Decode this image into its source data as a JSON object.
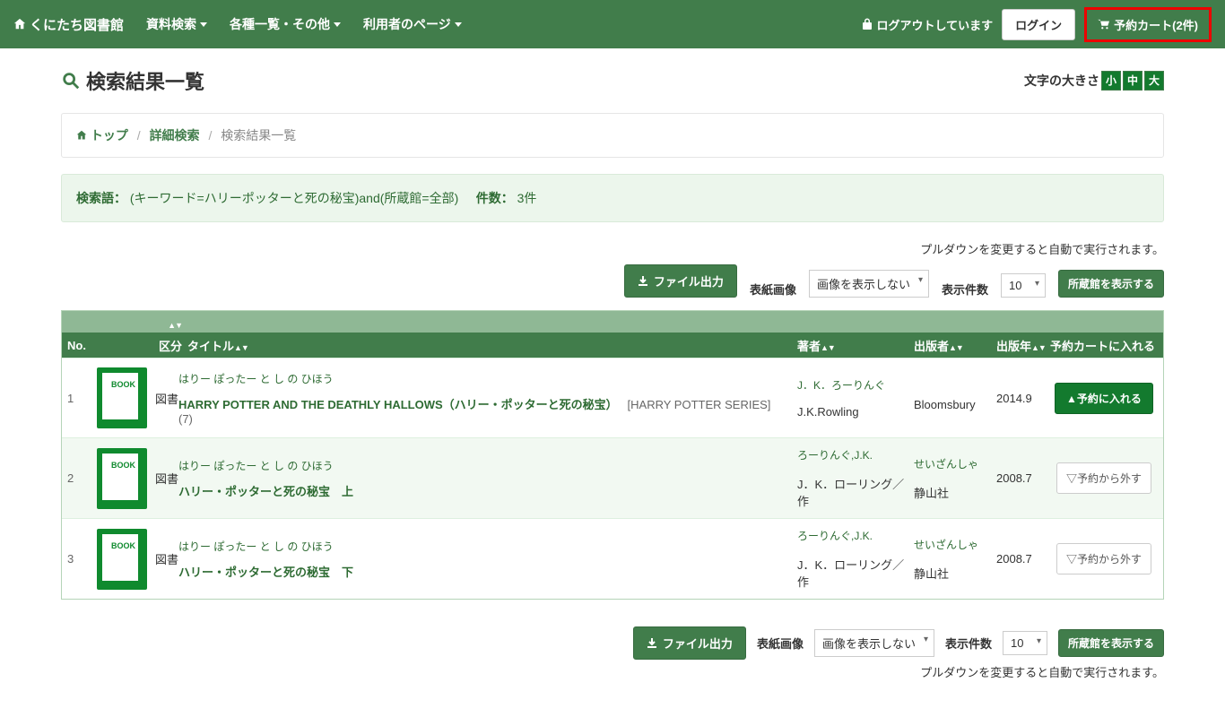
{
  "nav": {
    "brand": "くにたち図書館",
    "items": [
      "資料検索",
      "各種一覧・その他",
      "利用者のページ"
    ],
    "logout_status": "ログアウトしています",
    "login": "ログイン",
    "cart": "予約カート(2件)"
  },
  "page": {
    "title": "検索結果一覧",
    "font_label": "文字の大きさ",
    "font_sizes": [
      "小",
      "中",
      "大"
    ]
  },
  "breadcrumb": {
    "top": "トップ",
    "detail": "詳細検索",
    "current": "検索結果一覧"
  },
  "search_info": {
    "term_label": "検索語：",
    "term_value": "(キーワード=ハリーポッターと死の秘宝)and(所蔵館=全部)",
    "count_label": "件数：",
    "count_value": "3件"
  },
  "controls": {
    "hint": "プルダウンを変更すると自動で実行されます。",
    "file_output": "ファイル出力",
    "cover_label": "表紙画像",
    "cover_value": "画像を表示しない",
    "page_label": "表示件数",
    "page_value": "10",
    "holdings": "所蔵館を表示する"
  },
  "table": {
    "headers": {
      "no": "No.",
      "kubun": "区分",
      "title": "タイトル",
      "author": "著者",
      "publisher": "出版者",
      "year": "出版年",
      "cart": "予約カートに入れる"
    }
  },
  "rows": [
    {
      "no": "1",
      "kubun": "図書",
      "yomi": "はりー ぽったー と し の ひほう",
      "title": "HARRY POTTER AND THE DEATHLY HALLOWS（ハリー・ポッターと死の秘宝）",
      "series": "[HARRY POTTER SERIES]",
      "vol": "(7)",
      "author_yomi": "J．K．ろーりんぐ",
      "author": "J.K.Rowling",
      "pub_yomi": "",
      "publisher": "Bloomsbury",
      "year": "2014.9",
      "in_cart": false,
      "btn_add": "▲予約に入れる"
    },
    {
      "no": "2",
      "kubun": "図書",
      "yomi": "はりー ぽったー と し の ひほう",
      "title": "ハリー・ポッターと死の秘宝　上",
      "series": "",
      "vol": "",
      "author_yomi": "ろーりんぐ,J.K.",
      "author": "J．K．ローリング／作",
      "pub_yomi": "せいざんしゃ",
      "publisher": "静山社",
      "year": "2008.7",
      "in_cart": true,
      "btn_remove": "▽予約から外す"
    },
    {
      "no": "3",
      "kubun": "図書",
      "yomi": "はりー ぽったー と し の ひほう",
      "title": "ハリー・ポッターと死の秘宝　下",
      "series": "",
      "vol": "",
      "author_yomi": "ろーりんぐ,J.K.",
      "author": "J．K．ローリング／作",
      "pub_yomi": "せいざんしゃ",
      "publisher": "静山社",
      "year": "2008.7",
      "in_cart": true,
      "btn_remove": "▽予約から外す"
    }
  ]
}
